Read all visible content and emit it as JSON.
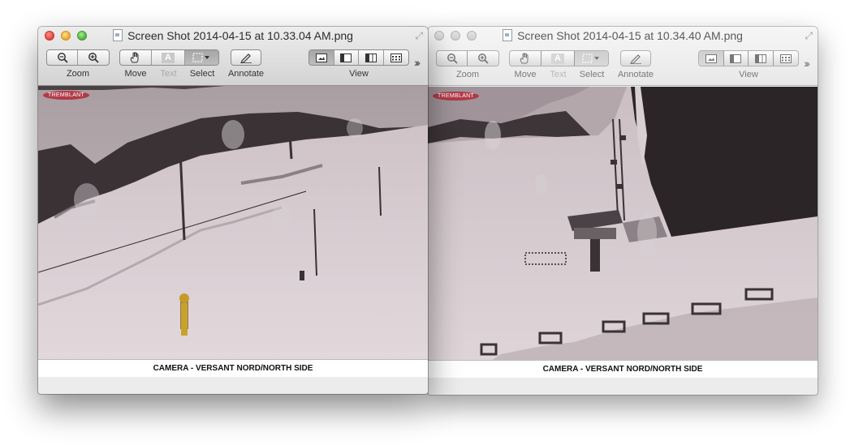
{
  "windows": [
    {
      "title": "Screen Shot 2014-04-15 at 10.33.04 AM.png",
      "toolbar": {
        "zoom_label": "Zoom",
        "move_label": "Move",
        "text_label": "Text",
        "select_label": "Select",
        "annotate_label": "Annotate",
        "view_label": "View"
      },
      "image": {
        "logo": "TREMBLANT",
        "caption": "CAMERA - VERSANT NORD/NORTH SIDE"
      }
    },
    {
      "title": "Screen Shot 2014-04-15 at 10.34.40 AM.png",
      "toolbar": {
        "zoom_label": "Zoom",
        "move_label": "Move",
        "text_label": "Text",
        "select_label": "Select",
        "annotate_label": "Annotate",
        "view_label": "View"
      },
      "image": {
        "logo": "TREMBLANT",
        "caption": "CAMERA - VERSANT NORD/NORTH SIDE"
      }
    }
  ],
  "icons": {
    "zoom_out": "magnifier-minus-icon",
    "zoom_in": "magnifier-plus-icon",
    "move": "hand-icon",
    "text": "text-A-icon",
    "select": "marquee-select-icon",
    "annotate": "pencil-icon",
    "view": [
      "single-page-icon",
      "sidebar-thumbnails-icon",
      "two-page-icon",
      "contact-sheet-icon"
    ]
  },
  "colors": {
    "close": "#e0443e",
    "minimize": "#e9a628",
    "maximize": "#4fb13c",
    "toolbar": "#d3d3d3",
    "snow": "#d9cfd3",
    "trees": "#2f2a2c"
  }
}
